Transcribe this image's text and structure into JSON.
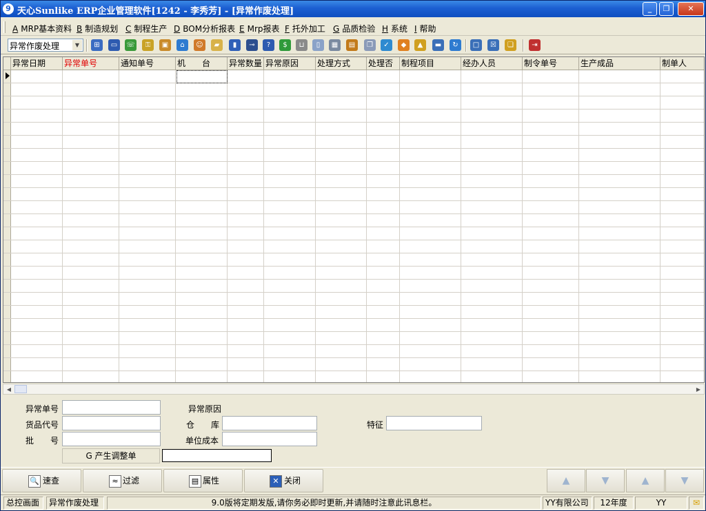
{
  "window": {
    "title": "天心Sunlike ERP企业管理软件[1242 - 李秀芳] - [异常作废处理]",
    "app_icon": "9"
  },
  "menu": [
    {
      "key": "A",
      "label": "MRP基本资料"
    },
    {
      "key": "B",
      "label": "制造规划"
    },
    {
      "key": "C",
      "label": "制程生产"
    },
    {
      "key": "D",
      "label": "BOM分析报表"
    },
    {
      "key": "E",
      "label": "Mrp报表"
    },
    {
      "key": "F",
      "label": "托外加工"
    },
    {
      "key": "G",
      "label": "品质检验"
    },
    {
      "key": "H",
      "label": "系统"
    },
    {
      "key": "I",
      "label": "帮助"
    }
  ],
  "toolbar": {
    "select_value": "异常作废处理",
    "icons": [
      "org-chart-icon",
      "monitor-icon",
      "phone-icon",
      "user-key-icon",
      "briefcase-icon",
      "home-icon",
      "group-icon",
      "folder-open-icon",
      "bookmark-icon",
      "pin-icon",
      "help-icon",
      "dollar-icon",
      "cart-icon",
      "document-icon",
      "calculator-icon",
      "archive-icon",
      "copy-icon",
      "check-icon",
      "bell-icon",
      "hierarchy-icon",
      "screen-icon",
      "refresh-icon",
      "window-icon",
      "close-box-icon",
      "tile-windows-icon",
      "exit-icon"
    ]
  },
  "grid": {
    "columns": [
      {
        "label": "异常日期",
        "highlight": false
      },
      {
        "label": "异常单号",
        "highlight": true
      },
      {
        "label": "通知单号",
        "highlight": false
      },
      {
        "label": "机　　台",
        "highlight": false
      },
      {
        "label": "异常数量",
        "highlight": false
      },
      {
        "label": "异常原因",
        "highlight": false
      },
      {
        "label": "处理方式",
        "highlight": false
      },
      {
        "label": "处理否",
        "highlight": false
      },
      {
        "label": "制程项目",
        "highlight": false
      },
      {
        "label": "经办人员",
        "highlight": false
      },
      {
        "label": "制令单号",
        "highlight": false
      },
      {
        "label": "生产成品",
        "highlight": false
      },
      {
        "label": "制单人",
        "highlight": false
      }
    ]
  },
  "form": {
    "abnormal_no_label": "异常单号",
    "abnormal_reason_label": "异常原因",
    "item_code_label": "货品代号",
    "warehouse_label": "仓　　库",
    "feature_label": "特征",
    "batch_label": "批　　号",
    "unit_cost_label": "单位成本",
    "generate_button": "G 产生调整单",
    "abnormal_no_value": "",
    "item_code_value": "",
    "batch_value": "",
    "warehouse_value": "",
    "unit_cost_value": "",
    "feature_value": "",
    "generate_value": ""
  },
  "actions": {
    "search": "速查",
    "filter": "过滤",
    "properties": "属性",
    "close": "关闭"
  },
  "status": {
    "main_screen": "总控画面",
    "current_tab": "异常作废处理",
    "message": "9.0版将定期发版,请你务必即时更新,并请随时注意此讯息栏。",
    "company": "YY有限公司",
    "year": "12年度",
    "user": "YY"
  },
  "colors": {
    "titlebar": "#1c5fd2",
    "header_highlight": "#e00000",
    "panel": "#ece9d8"
  }
}
